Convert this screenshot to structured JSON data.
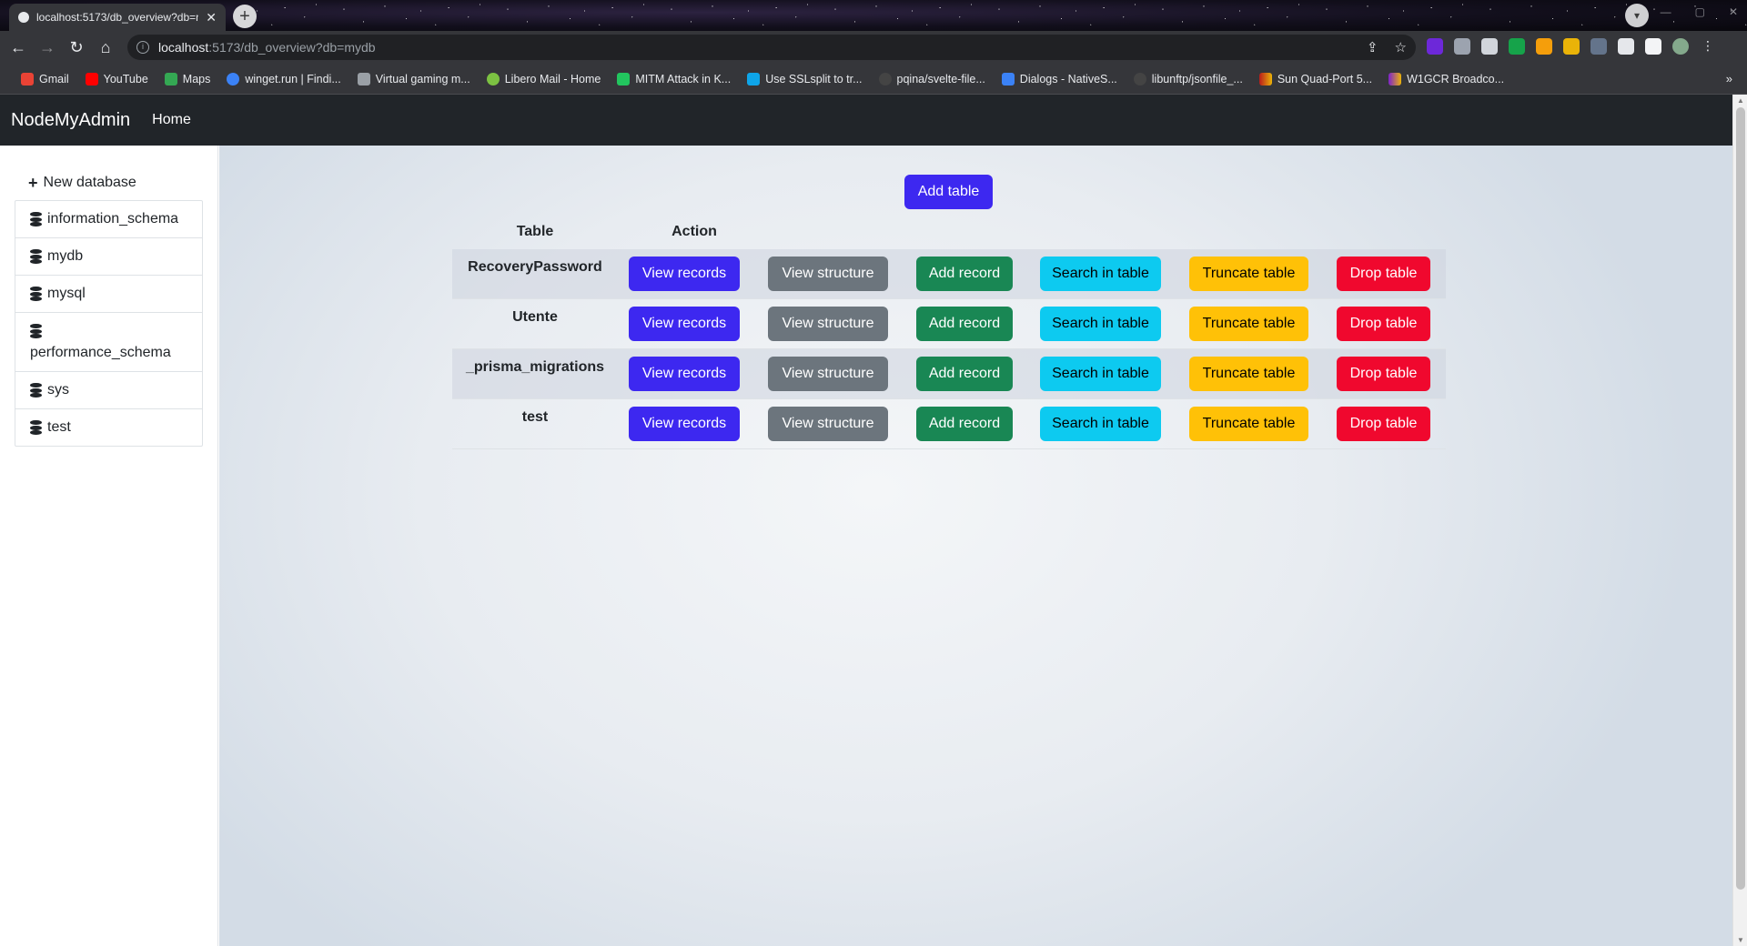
{
  "browser": {
    "tab_title": "localhost:5173/db_overview?db=mydb",
    "new_tab": "+",
    "tab_close": "✕",
    "url_host": "localhost",
    "url_rest": ":5173/db_overview?db=mydb",
    "bookmarks": [
      {
        "label": "Gmail",
        "color": "#ea4335"
      },
      {
        "label": "YouTube",
        "color": "#ff0000"
      },
      {
        "label": "Maps",
        "color": "#34a853"
      },
      {
        "label": "winget.run | Findi...",
        "color": "#3b82f6"
      },
      {
        "label": "Virtual gaming m...",
        "color": "#9aa0a6"
      },
      {
        "label": "Libero Mail - Home",
        "color": "#7cc242"
      },
      {
        "label": "MITM Attack in K...",
        "color": "#22c55e"
      },
      {
        "label": "Use SSLsplit to tr...",
        "color": "#0ea5e9"
      },
      {
        "label": "pqina/svelte-file...",
        "color": "#444444"
      },
      {
        "label": "Dialogs - NativeS...",
        "color": "#3b82f6"
      },
      {
        "label": "libunftp/jsonfile_...",
        "color": "#444444"
      },
      {
        "label": "Sun Quad-Port 5...",
        "color": "#b91c1c"
      },
      {
        "label": "W1GCR Broadco...",
        "color": "#7e22ce"
      }
    ],
    "more": "»"
  },
  "app": {
    "brand": "NodeMyAdmin",
    "nav_home": "Home",
    "sidebar": {
      "new_database": "New database",
      "databases": [
        "information_schema",
        "mydb",
        "mysql",
        "performance_schema",
        "sys",
        "test"
      ]
    },
    "main": {
      "add_table": "Add table",
      "headers": {
        "table": "Table",
        "action": "Action"
      },
      "actions": {
        "view_records": "View records",
        "view_structure": "View structure",
        "add_record": "Add record",
        "search_in_table": "Search in table",
        "truncate_table": "Truncate table",
        "drop_table": "Drop table"
      },
      "tables": [
        "RecoveryPassword",
        "Utente",
        "_prisma_migrations",
        "test"
      ]
    }
  },
  "colors": {
    "primary": "#3d28f0",
    "secondary": "#6c757d",
    "success": "#198754",
    "info": "#0dcaf0",
    "warning": "#ffc107",
    "danger": "#f0082e",
    "navbar": "#212529"
  }
}
